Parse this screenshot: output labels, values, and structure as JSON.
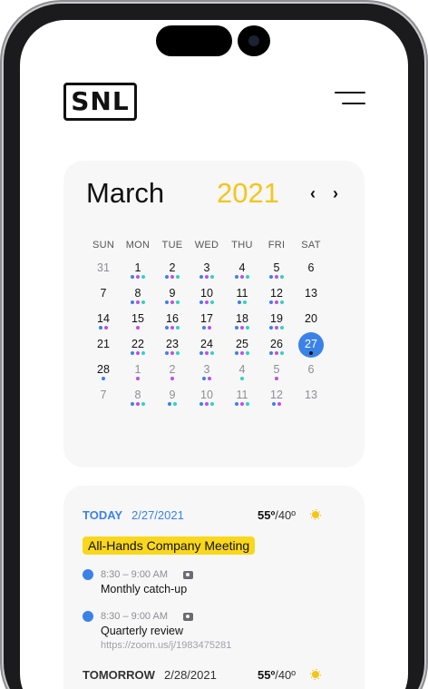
{
  "header": {
    "logo_text": "SNL",
    "menu_icon": "hamburger-icon"
  },
  "calendar": {
    "month": "March",
    "year": "2021",
    "prev_icon": "‹",
    "next_icon": "›",
    "weekdays": [
      "SUN",
      "MON",
      "TUE",
      "WED",
      "THU",
      "FRI",
      "SAT"
    ],
    "selected_day": "27",
    "colors": {
      "accent": "#3b82e8",
      "year": "#f5c518",
      "dot_blue": "#3b82e8",
      "dot_purple": "#c04cf0",
      "dot_teal": "#2dd4bf"
    },
    "weeks": [
      [
        {
          "d": "31",
          "m": "prev",
          "dots": []
        },
        {
          "d": "1",
          "m": "cur",
          "dots": [
            "blue",
            "purple",
            "teal"
          ]
        },
        {
          "d": "2",
          "m": "cur",
          "dots": [
            "blue",
            "purple",
            "teal"
          ]
        },
        {
          "d": "3",
          "m": "cur",
          "dots": [
            "blue",
            "purple",
            "teal"
          ]
        },
        {
          "d": "4",
          "m": "cur",
          "dots": [
            "blue",
            "purple",
            "teal"
          ]
        },
        {
          "d": "5",
          "m": "cur",
          "dots": [
            "blue",
            "purple",
            "teal"
          ]
        },
        {
          "d": "6",
          "m": "cur",
          "dots": []
        }
      ],
      [
        {
          "d": "7",
          "m": "cur",
          "dots": []
        },
        {
          "d": "8",
          "m": "cur",
          "dots": [
            "blue",
            "purple",
            "teal"
          ]
        },
        {
          "d": "9",
          "m": "cur",
          "dots": [
            "blue",
            "purple",
            "teal"
          ]
        },
        {
          "d": "10",
          "m": "cur",
          "dots": [
            "blue",
            "purple",
            "teal"
          ]
        },
        {
          "d": "11",
          "m": "cur",
          "dots": [
            "blue",
            "teal"
          ]
        },
        {
          "d": "12",
          "m": "cur",
          "dots": [
            "blue",
            "purple",
            "teal"
          ]
        },
        {
          "d": "13",
          "m": "cur",
          "dots": []
        }
      ],
      [
        {
          "d": "14",
          "m": "cur",
          "dots": [
            "blue",
            "purple"
          ]
        },
        {
          "d": "15",
          "m": "cur",
          "dots": [
            "purple"
          ]
        },
        {
          "d": "16",
          "m": "cur",
          "dots": [
            "blue",
            "purple",
            "teal"
          ]
        },
        {
          "d": "17",
          "m": "cur",
          "dots": [
            "blue",
            "purple"
          ]
        },
        {
          "d": "18",
          "m": "cur",
          "dots": [
            "blue",
            "purple",
            "teal"
          ]
        },
        {
          "d": "19",
          "m": "cur",
          "dots": [
            "blue",
            "purple",
            "teal"
          ]
        },
        {
          "d": "20",
          "m": "cur",
          "dots": []
        }
      ],
      [
        {
          "d": "21",
          "m": "cur",
          "dots": []
        },
        {
          "d": "22",
          "m": "cur",
          "dots": [
            "blue",
            "purple",
            "teal"
          ]
        },
        {
          "d": "23",
          "m": "cur",
          "dots": [
            "blue",
            "purple",
            "teal"
          ]
        },
        {
          "d": "24",
          "m": "cur",
          "dots": [
            "blue",
            "purple",
            "teal"
          ]
        },
        {
          "d": "25",
          "m": "cur",
          "dots": [
            "blue",
            "purple",
            "teal"
          ]
        },
        {
          "d": "26",
          "m": "cur",
          "dots": [
            "blue",
            "purple",
            "teal"
          ]
        },
        {
          "d": "27",
          "m": "cur",
          "dots": [
            "dark"
          ]
        }
      ],
      [
        {
          "d": "28",
          "m": "cur",
          "dots": [
            "blue"
          ]
        },
        {
          "d": "1",
          "m": "next",
          "dots": [
            "purple"
          ]
        },
        {
          "d": "2",
          "m": "next",
          "dots": [
            "purple"
          ]
        },
        {
          "d": "3",
          "m": "next",
          "dots": [
            "blue",
            "purple"
          ]
        },
        {
          "d": "4",
          "m": "next",
          "dots": [
            "teal"
          ]
        },
        {
          "d": "5",
          "m": "next",
          "dots": [
            "purple"
          ]
        },
        {
          "d": "6",
          "m": "next",
          "dots": []
        }
      ],
      [
        {
          "d": "7",
          "m": "next",
          "dots": []
        },
        {
          "d": "8",
          "m": "next",
          "dots": [
            "blue",
            "purple",
            "teal"
          ]
        },
        {
          "d": "9",
          "m": "next",
          "dots": [
            "blue",
            "teal"
          ]
        },
        {
          "d": "10",
          "m": "next",
          "dots": [
            "blue",
            "purple",
            "teal"
          ]
        },
        {
          "d": "11",
          "m": "next",
          "dots": [
            "blue",
            "purple",
            "teal"
          ]
        },
        {
          "d": "12",
          "m": "next",
          "dots": [
            "blue",
            "purple"
          ]
        },
        {
          "d": "13",
          "m": "next",
          "dots": []
        }
      ]
    ]
  },
  "today": {
    "label": "TODAY",
    "date": "2/27/2021",
    "temp_high": "55º",
    "temp_low": "/40º",
    "weather_icon": "sun-icon",
    "highlight_event": "All-Hands Company Meeting",
    "events": [
      {
        "time": "8:30 – 9:00 AM",
        "title": "Monthly catch-up",
        "link": "",
        "icon": "video-icon"
      },
      {
        "time": "8:30 – 9:00 AM",
        "title": "Quarterly review",
        "link": "https://zoom.us/j/1983475281",
        "icon": "video-icon"
      }
    ]
  },
  "tomorrow": {
    "label": "TOMORROW",
    "date": "2/28/2021",
    "temp_high": "55º",
    "temp_low": "/40º",
    "weather_icon": "sun-icon"
  }
}
